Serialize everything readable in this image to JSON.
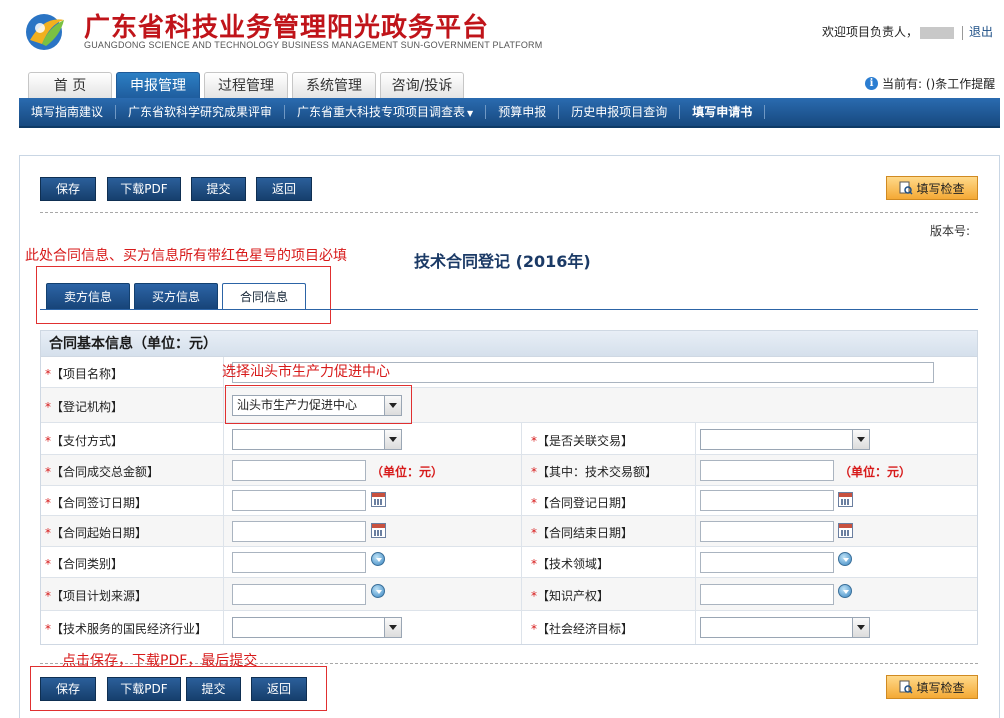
{
  "header": {
    "title": "广东省科技业务管理阳光政务平台",
    "subtitle": "GUANGDONG SCIENCE AND TECHNOLOGY BUSINESS MANAGEMENT SUN-GOVERNMENT PLATFORM",
    "welcome": "欢迎项目负责人，",
    "logout": "退出"
  },
  "main_tabs": [
    {
      "label": "首 页"
    },
    {
      "label": "申报管理"
    },
    {
      "label": "过程管理"
    },
    {
      "label": "系统管理"
    },
    {
      "label": "咨询/投诉"
    }
  ],
  "notice": "当前有: ()条工作提醒",
  "sub_nav": [
    {
      "label": "填写指南建议"
    },
    {
      "label": "广东省软科学研究成果评审"
    },
    {
      "label": "广东省重大科技专项项目调查表"
    },
    {
      "label": "预算申报"
    },
    {
      "label": "历史申报项目查询"
    },
    {
      "label": "填写申请书"
    }
  ],
  "toolbar": {
    "save": "保存",
    "download_pdf": "下载PDF",
    "submit": "提交",
    "back": "返回",
    "check": "填写检查"
  },
  "version_label": "版本号:",
  "annotations": {
    "required_note": "此处合同信息、买方信息所有带红色星号的项目必填",
    "select_note": "选择汕头市生产力促进中心",
    "bottom_note": "点击保存，下载PDF，最后提交"
  },
  "page_title": "技术合同登记 (2016年)",
  "form_tabs": [
    {
      "label": "卖方信息"
    },
    {
      "label": "买方信息"
    },
    {
      "label": "合同信息"
    }
  ],
  "form": {
    "section_title": "合同基本信息（单位：元）",
    "star": "*",
    "unit": "（单位：元）",
    "fields": {
      "project_name": "【项目名称】",
      "registry": "【登记机构】",
      "registry_value": "汕头市生产力促进中心",
      "payment": "【支付方式】",
      "related_trade": "【是否关联交易】",
      "total_amount": "【合同成交总金额】",
      "tech_amount": "【其中：技术交易额】",
      "sign_date": "【合同签订日期】",
      "register_date": "【合同登记日期】",
      "start_date": "【合同起始日期】",
      "end_date": "【合同结束日期】",
      "contract_type": "【合同类别】",
      "tech_field": "【技术领域】",
      "plan_source": "【项目计划来源】",
      "ip": "【知识产权】",
      "industry": "【技术服务的国民经济行业】",
      "social_goal": "【社会经济目标】"
    }
  },
  "colors": {
    "brand_red": "#c0141a",
    "nav_blue": "#1f5d9e",
    "annotation_red": "#d71a1a",
    "check_orange": "#f4a935"
  }
}
